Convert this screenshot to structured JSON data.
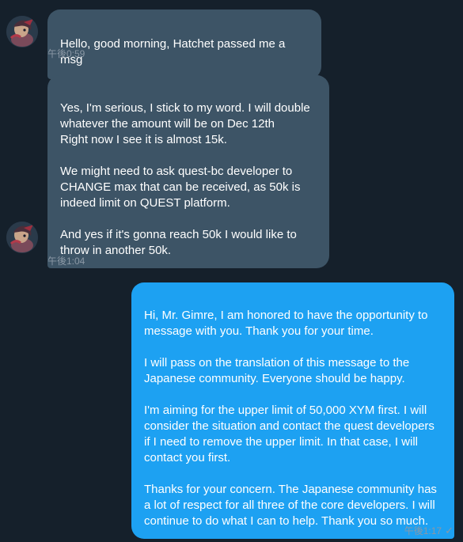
{
  "conversation": {
    "messages": [
      {
        "direction": "in",
        "text": "Hello, good morning, Hatchet passed me a msg",
        "time": "午後0:59"
      },
      {
        "direction": "in",
        "text": "Yes, I'm serious, I stick to my word. I will double whatever the amount will be on Dec 12th\nRight now I see it is almost 15k.\n\nWe might need to ask quest-bc developer to CHANGE max that can be received, as 50k is indeed limit on QUEST platform.\n\nAnd yes if it's gonna reach 50k I would like to throw in another 50k.",
        "time": "午後1:04"
      },
      {
        "direction": "out",
        "text": "Hi, Mr. Gimre, I am honored to have the opportunity to message with you. Thank you for your time.\n\nI will pass on the translation of this message to the Japanese community. Everyone should be happy.\n\nI'm aiming for the upper limit of 50,000 XYM first. I will consider the situation and contact the quest developers if I need to remove the upper limit. In that case, I will contact you first.\n\nThanks for your concern. The Japanese community has a lot of respect for all three of the core developers. I will continue to do what I can to help. Thank you so much.",
        "time": "午後1:17",
        "status_icon": "checkmark-icon"
      }
    ]
  },
  "colors": {
    "background": "#15202b",
    "incoming_bubble": "#3d5466",
    "outgoing_bubble": "#1da1f2",
    "timestamp": "#8b98a5"
  }
}
